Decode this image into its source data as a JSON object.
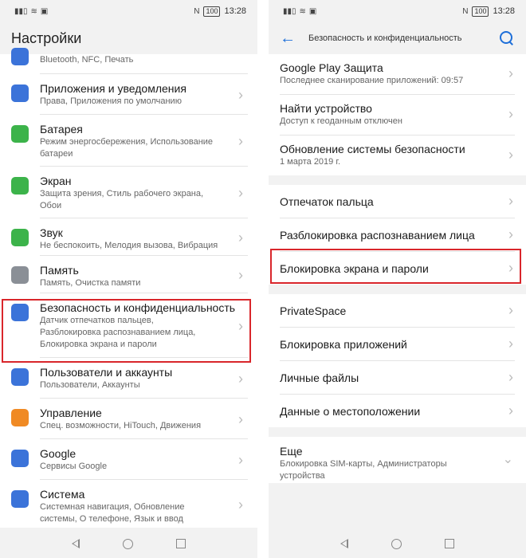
{
  "status": {
    "time": "13:28",
    "battery": "100"
  },
  "left": {
    "title": "Настройки",
    "top_partial": "Bluetooth, NFC, Печать",
    "items": [
      {
        "title": "Приложения и уведомления",
        "sub1": "Права, Приложения по умолчанию",
        "sub2": "",
        "sub3": "",
        "icon": "apps-icon",
        "color": "#3b73d9"
      },
      {
        "title": "Батарея",
        "sub1": "Режим энергосбережения, Использование",
        "sub2": "батареи",
        "sub3": "",
        "icon": "battery-icon",
        "color": "#3cb34a"
      },
      {
        "title": "Экран",
        "sub1": "Защита зрения, Стиль рабочего экрана,",
        "sub2": "Обои",
        "sub3": "",
        "icon": "display-icon",
        "color": "#3cb34a"
      },
      {
        "title": "Звук",
        "sub1": "Не беспокоить, Мелодия вызова, Вибрация",
        "sub2": "",
        "sub3": "",
        "icon": "sound-icon",
        "color": "#3cb34a"
      },
      {
        "title": "Память",
        "sub1": "Память, Очистка памяти",
        "sub2": "",
        "sub3": "",
        "icon": "storage-icon",
        "color": "#8a8f96"
      },
      {
        "title": "Безопасность и конфиденциальность",
        "sub1": "Датчик отпечатков пальцев,",
        "sub2": "Разблокировка распознаванием лица,",
        "sub3": "Блокировка экрана и пароли",
        "icon": "shield-icon",
        "color": "#3b73d9"
      },
      {
        "title": "Пользователи и аккаунты",
        "sub1": "Пользователи, Аккаунты",
        "sub2": "",
        "sub3": "",
        "icon": "user-icon",
        "color": "#3b73d9"
      },
      {
        "title": "Управление",
        "sub1": "Спец. возможности, HiTouch, Движения",
        "sub2": "",
        "sub3": "",
        "icon": "hand-icon",
        "color": "#f08a24"
      },
      {
        "title": "Google",
        "sub1": "Сервисы Google",
        "sub2": "",
        "sub3": "",
        "icon": "google-icon",
        "color": "#3b73d9"
      },
      {
        "title": "Система",
        "sub1": "Системная навигация, Обновление",
        "sub2": "системы, О телефоне, Язык и ввод",
        "sub3": "",
        "icon": "system-icon",
        "color": "#3b73d9"
      }
    ]
  },
  "right": {
    "title": "Безопасность и конфиденциальность",
    "group1": [
      {
        "title": "Google Play Защита",
        "sub": "Последнее сканирование приложений: 09:57"
      },
      {
        "title": "Найти устройство",
        "sub": "Доступ к геоданным отключен"
      },
      {
        "title": "Обновление системы безопасности",
        "sub": "1 марта 2019 г."
      }
    ],
    "group2": [
      {
        "title": "Отпечаток пальца"
      },
      {
        "title": "Разблокировка распознаванием лица"
      },
      {
        "title": "Блокировка экрана и пароли"
      }
    ],
    "group3": [
      {
        "title": "PrivateSpace"
      },
      {
        "title": "Блокировка приложений"
      },
      {
        "title": "Личные файлы"
      },
      {
        "title": "Данные о местоположении"
      }
    ],
    "more": {
      "title": "Еще",
      "sub1": "Блокировка SIM-карты, Администраторы",
      "sub2": "устройства"
    }
  }
}
